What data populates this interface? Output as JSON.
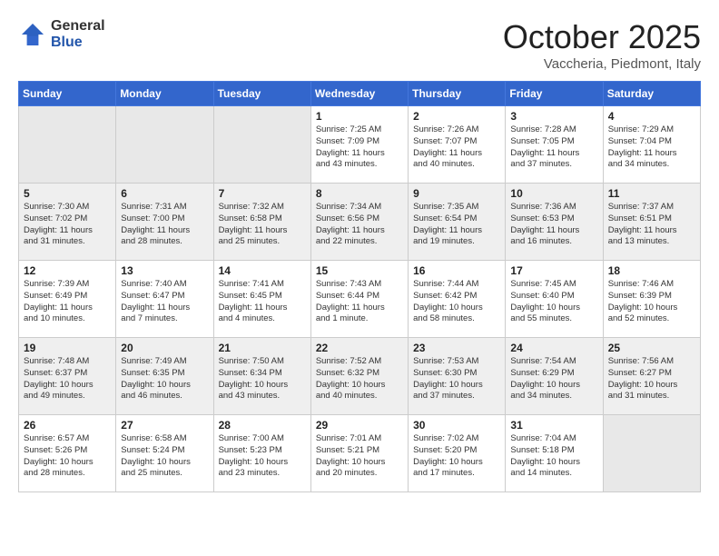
{
  "header": {
    "logo_general": "General",
    "logo_blue": "Blue",
    "title": "October 2025",
    "location": "Vaccheria, Piedmont, Italy"
  },
  "days_of_week": [
    "Sunday",
    "Monday",
    "Tuesday",
    "Wednesday",
    "Thursday",
    "Friday",
    "Saturday"
  ],
  "weeks": [
    [
      {
        "day": "",
        "info": ""
      },
      {
        "day": "",
        "info": ""
      },
      {
        "day": "",
        "info": ""
      },
      {
        "day": "1",
        "info": "Sunrise: 7:25 AM\nSunset: 7:09 PM\nDaylight: 11 hours\nand 43 minutes."
      },
      {
        "day": "2",
        "info": "Sunrise: 7:26 AM\nSunset: 7:07 PM\nDaylight: 11 hours\nand 40 minutes."
      },
      {
        "day": "3",
        "info": "Sunrise: 7:28 AM\nSunset: 7:05 PM\nDaylight: 11 hours\nand 37 minutes."
      },
      {
        "day": "4",
        "info": "Sunrise: 7:29 AM\nSunset: 7:04 PM\nDaylight: 11 hours\nand 34 minutes."
      }
    ],
    [
      {
        "day": "5",
        "info": "Sunrise: 7:30 AM\nSunset: 7:02 PM\nDaylight: 11 hours\nand 31 minutes."
      },
      {
        "day": "6",
        "info": "Sunrise: 7:31 AM\nSunset: 7:00 PM\nDaylight: 11 hours\nand 28 minutes."
      },
      {
        "day": "7",
        "info": "Sunrise: 7:32 AM\nSunset: 6:58 PM\nDaylight: 11 hours\nand 25 minutes."
      },
      {
        "day": "8",
        "info": "Sunrise: 7:34 AM\nSunset: 6:56 PM\nDaylight: 11 hours\nand 22 minutes."
      },
      {
        "day": "9",
        "info": "Sunrise: 7:35 AM\nSunset: 6:54 PM\nDaylight: 11 hours\nand 19 minutes."
      },
      {
        "day": "10",
        "info": "Sunrise: 7:36 AM\nSunset: 6:53 PM\nDaylight: 11 hours\nand 16 minutes."
      },
      {
        "day": "11",
        "info": "Sunrise: 7:37 AM\nSunset: 6:51 PM\nDaylight: 11 hours\nand 13 minutes."
      }
    ],
    [
      {
        "day": "12",
        "info": "Sunrise: 7:39 AM\nSunset: 6:49 PM\nDaylight: 11 hours\nand 10 minutes."
      },
      {
        "day": "13",
        "info": "Sunrise: 7:40 AM\nSunset: 6:47 PM\nDaylight: 11 hours\nand 7 minutes."
      },
      {
        "day": "14",
        "info": "Sunrise: 7:41 AM\nSunset: 6:45 PM\nDaylight: 11 hours\nand 4 minutes."
      },
      {
        "day": "15",
        "info": "Sunrise: 7:43 AM\nSunset: 6:44 PM\nDaylight: 11 hours\nand 1 minute."
      },
      {
        "day": "16",
        "info": "Sunrise: 7:44 AM\nSunset: 6:42 PM\nDaylight: 10 hours\nand 58 minutes."
      },
      {
        "day": "17",
        "info": "Sunrise: 7:45 AM\nSunset: 6:40 PM\nDaylight: 10 hours\nand 55 minutes."
      },
      {
        "day": "18",
        "info": "Sunrise: 7:46 AM\nSunset: 6:39 PM\nDaylight: 10 hours\nand 52 minutes."
      }
    ],
    [
      {
        "day": "19",
        "info": "Sunrise: 7:48 AM\nSunset: 6:37 PM\nDaylight: 10 hours\nand 49 minutes."
      },
      {
        "day": "20",
        "info": "Sunrise: 7:49 AM\nSunset: 6:35 PM\nDaylight: 10 hours\nand 46 minutes."
      },
      {
        "day": "21",
        "info": "Sunrise: 7:50 AM\nSunset: 6:34 PM\nDaylight: 10 hours\nand 43 minutes."
      },
      {
        "day": "22",
        "info": "Sunrise: 7:52 AM\nSunset: 6:32 PM\nDaylight: 10 hours\nand 40 minutes."
      },
      {
        "day": "23",
        "info": "Sunrise: 7:53 AM\nSunset: 6:30 PM\nDaylight: 10 hours\nand 37 minutes."
      },
      {
        "day": "24",
        "info": "Sunrise: 7:54 AM\nSunset: 6:29 PM\nDaylight: 10 hours\nand 34 minutes."
      },
      {
        "day": "25",
        "info": "Sunrise: 7:56 AM\nSunset: 6:27 PM\nDaylight: 10 hours\nand 31 minutes."
      }
    ],
    [
      {
        "day": "26",
        "info": "Sunrise: 6:57 AM\nSunset: 5:26 PM\nDaylight: 10 hours\nand 28 minutes."
      },
      {
        "day": "27",
        "info": "Sunrise: 6:58 AM\nSunset: 5:24 PM\nDaylight: 10 hours\nand 25 minutes."
      },
      {
        "day": "28",
        "info": "Sunrise: 7:00 AM\nSunset: 5:23 PM\nDaylight: 10 hours\nand 23 minutes."
      },
      {
        "day": "29",
        "info": "Sunrise: 7:01 AM\nSunset: 5:21 PM\nDaylight: 10 hours\nand 20 minutes."
      },
      {
        "day": "30",
        "info": "Sunrise: 7:02 AM\nSunset: 5:20 PM\nDaylight: 10 hours\nand 17 minutes."
      },
      {
        "day": "31",
        "info": "Sunrise: 7:04 AM\nSunset: 5:18 PM\nDaylight: 10 hours\nand 14 minutes."
      },
      {
        "day": "",
        "info": ""
      }
    ]
  ]
}
